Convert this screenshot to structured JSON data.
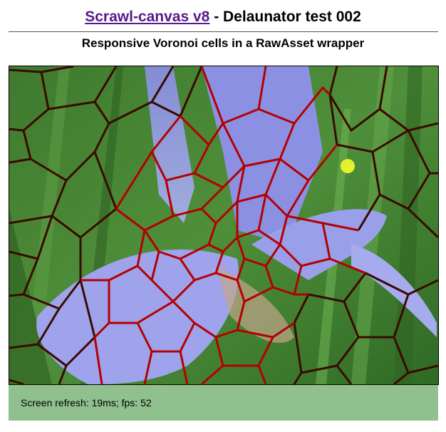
{
  "header": {
    "link_text": "Scrawl-canvas v8",
    "title_rest": " - Delaunator test 002",
    "subtitle": "Responsive Voronoi cells in a RawAsset wrapper"
  },
  "status": {
    "report": "Screen refresh: 19ms; fps: 52"
  },
  "colors": {
    "report_background": "#8fc08d",
    "voronoi_stroke_center": "#c40000",
    "voronoi_stroke_edge": "#3a0a00",
    "link": "#551a8b"
  }
}
